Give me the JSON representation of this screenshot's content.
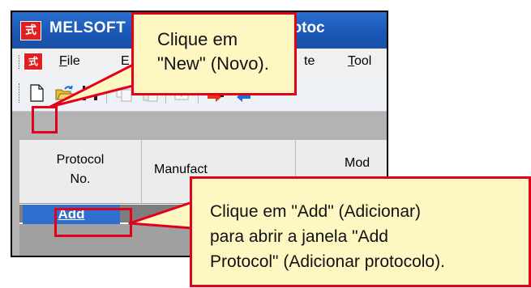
{
  "window": {
    "title_left": "MELSOFT",
    "title_right": "ed Protoc",
    "logo_glyph": "式"
  },
  "menubar": {
    "items": [
      {
        "label": "File",
        "accel": "F"
      },
      {
        "label": "E",
        "accel": ""
      },
      {
        "label": "te",
        "accel": ""
      },
      {
        "label": "Tool",
        "accel": "T"
      }
    ]
  },
  "toolbar": {
    "buttons": [
      {
        "icon": "new-document-icon",
        "enabled": true
      },
      {
        "icon": "open-folder-icon",
        "enabled": true
      },
      {
        "icon": "save-disk-icon",
        "enabled": true
      },
      {
        "icon": "copy-icon",
        "enabled": false
      },
      {
        "icon": "paste-icon",
        "enabled": false
      },
      {
        "icon": "edit-icon",
        "enabled": false
      },
      {
        "icon": "write-to-plc-icon",
        "enabled": true
      },
      {
        "icon": "read-from-plc-icon",
        "enabled": true
      }
    ]
  },
  "grid": {
    "col_protocol_no": "Protocol\nNo.",
    "col_protocol_no_l1": "Protocol",
    "col_protocol_no_l2": "No.",
    "col_manufacturer": "Manufact",
    "col_model": "Mod",
    "add_label": "Add"
  },
  "callouts": {
    "new": {
      "line1": "Clique em",
      "line2": "\"New\" (Novo)."
    },
    "add": {
      "line1": "Clique em \"Add\" (Adicionar)",
      "line2": "para abrir a janela \"Add",
      "line3": "Protocol\" (Adicionar protocolo)."
    }
  },
  "colors": {
    "highlight": "#e3001b",
    "callout_fill": "#fff7c2",
    "titlebar": "#1a56b4",
    "add_link_bg": "#2f6fcf"
  }
}
